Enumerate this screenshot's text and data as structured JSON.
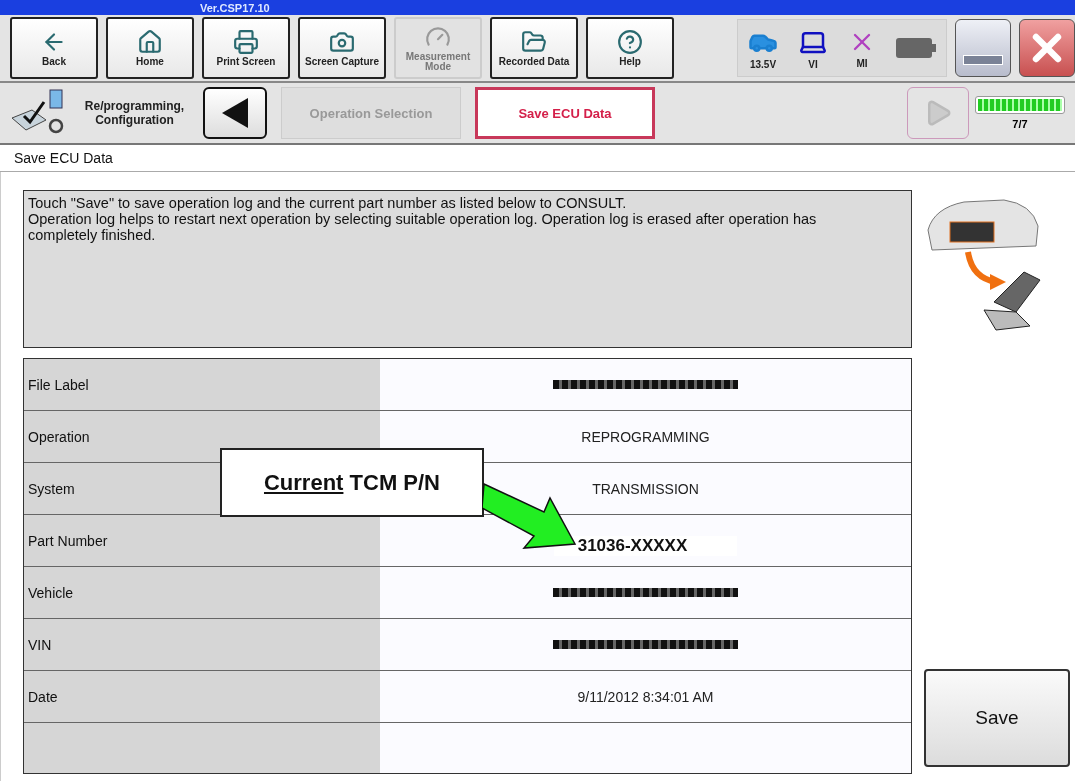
{
  "window": {
    "title": "Ver.CSP17.10"
  },
  "toolbar": [
    {
      "label": "Back",
      "disabled": false
    },
    {
      "label": "Home",
      "disabled": false
    },
    {
      "label": "Print Screen",
      "disabled": false
    },
    {
      "label": "Screen Capture",
      "disabled": false
    },
    {
      "label": "Measurement Mode",
      "disabled": true
    },
    {
      "label": "Recorded Data",
      "disabled": false
    },
    {
      "label": "Help",
      "disabled": false
    }
  ],
  "status": [
    {
      "label": "13.5V"
    },
    {
      "label": "VI"
    },
    {
      "label": "MI"
    }
  ],
  "breadcrumb": {
    "title": "Re/programming, Configuration",
    "steps": [
      {
        "label": "Operation Selection",
        "selected": false
      },
      {
        "label": "Save ECU Data",
        "selected": true
      }
    ],
    "next_disabled": true,
    "progress": {
      "level": 1,
      "text": "7/7"
    }
  },
  "section_title": "Save ECU Data",
  "message": "Touch \"Save\" to save operation log and the current part number as listed below to CONSULT.\nOperation log helps to restart next operation by selecting suitable operation log. Operation log is erased after operation has completely finished.",
  "rows": [
    {
      "label": "File Label",
      "kind": "masked"
    },
    {
      "label": "Operation",
      "kind": "text",
      "value": "REPROGRAMMING"
    },
    {
      "label": "System",
      "kind": "text",
      "value": "TRANSMISSION"
    },
    {
      "label": "Part Number",
      "kind": "highlight",
      "value": "31036-XXXXX"
    },
    {
      "label": "Vehicle",
      "kind": "masked"
    },
    {
      "label": "VIN",
      "kind": "masked"
    },
    {
      "label": "Date",
      "kind": "text",
      "value": "9/11/2012 8:34:01 AM"
    }
  ],
  "callout": {
    "underlined": "Current",
    "text": "TCM P/N"
  },
  "save_button": "Save"
}
